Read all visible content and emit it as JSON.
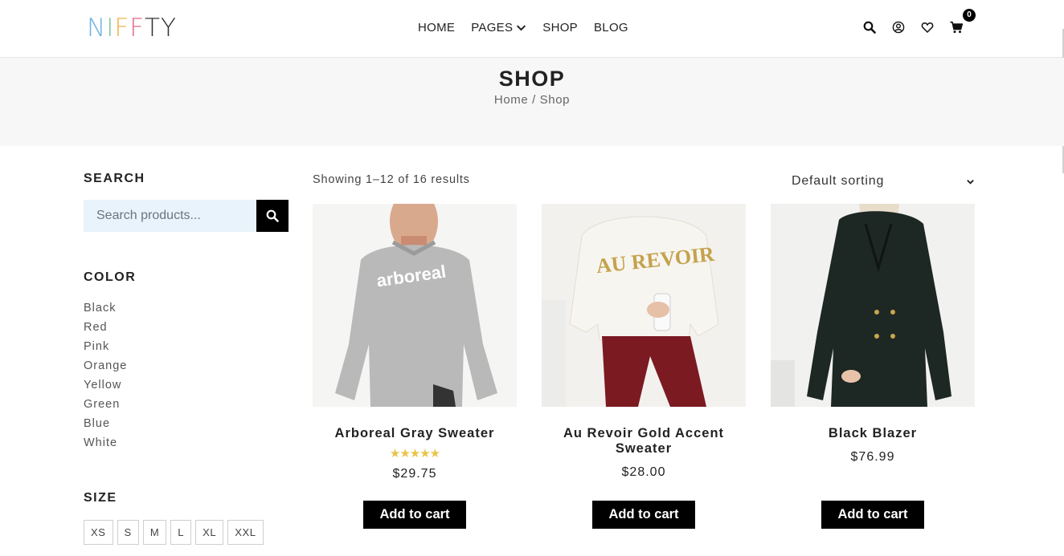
{
  "header": {
    "logo_letters": [
      "N",
      "I",
      "F",
      "F",
      "T",
      "Y"
    ],
    "logo_colors": [
      "#6fb3e0",
      "#7fc6a4",
      "#f0b34b",
      "#e46a8a",
      "#333333",
      "#333333"
    ],
    "nav": [
      {
        "label": "HOME"
      },
      {
        "label": "PAGES"
      },
      {
        "label": "SHOP"
      },
      {
        "label": "BLOG"
      }
    ],
    "icons": [
      "search-icon",
      "user-icon",
      "heart-icon",
      "cart-icon"
    ],
    "cart_count": "0"
  },
  "banner": {
    "title": "SHOP",
    "breadcrumb_home": "Home",
    "breadcrumb_sep": " / ",
    "breadcrumb_current": "Shop"
  },
  "sidebar": {
    "search_title": "SEARCH",
    "search_placeholder": "Search products...",
    "color_title": "COLOR",
    "colors": [
      "Black",
      "Red",
      "Pink",
      "Orange",
      "Yellow",
      "Green",
      "Blue",
      "White"
    ],
    "size_title": "SIZE",
    "sizes": [
      "XS",
      "S",
      "M",
      "L",
      "XL",
      "XXL"
    ]
  },
  "main": {
    "results_text": "Showing 1–12 of 16 results",
    "sorting_value": "Default sorting",
    "products": [
      {
        "name": "Arboreal Gray Sweater",
        "rating": 5,
        "stars": "★★★★★",
        "price": "$29.75",
        "button": "Add to cart"
      },
      {
        "name": "Au Revoir Gold Accent Sweater",
        "price": "$28.00",
        "button": "Add to cart"
      },
      {
        "name": "Black Blazer",
        "price": "$76.99",
        "button": "Add to cart"
      }
    ]
  },
  "colors": {
    "accent": "#000000",
    "banner_bg": "#f7f7f7",
    "search_bg": "#e9f3fb",
    "star": "#e8c547"
  }
}
